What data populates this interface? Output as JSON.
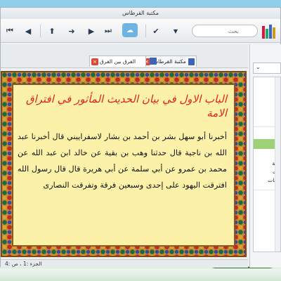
{
  "window": {
    "title": "مكتبة القرطاس"
  },
  "toolbar": {
    "icons": [
      "first-icon",
      "back-icon",
      "upload-icon",
      "prev-icon",
      "next-icon",
      "last-icon",
      "search-icon",
      "check-icon",
      "books-icon"
    ],
    "search_placeholder": "بحث"
  },
  "tabs": [
    {
      "label": "مكتبة القرطاس"
    },
    {
      "label": "الفرق بين الفرق"
    }
  ],
  "book": {
    "chapter_title": "الباب الاول في بيان الحديث المأثور في افتراق الامة",
    "body": "أخبرنا أبو سهل بشر بن أحمد بن بشار لاسفراييني قال أخبرنا عبد الله بن ناجية قال حدثنا وهب بن بقية عن خالد ابن عبد الله عن محمد بن عمرو عن أبي سلمة عن أبي هريرة قال قال رسول الله افترقت اليهود على إحدى وسبعين فرقة وتفرقت النصارى"
  },
  "side_panel": {
    "tree_items": [
      "فة",
      "ت",
      "عات"
    ]
  },
  "status": {
    "text": "الجزء :1 ، ص :4"
  },
  "colors": {
    "accent": "#6fb3e4",
    "title_red": "#e0241c",
    "page_bg": "#fbf1a8",
    "frame": "#c88a3a"
  }
}
